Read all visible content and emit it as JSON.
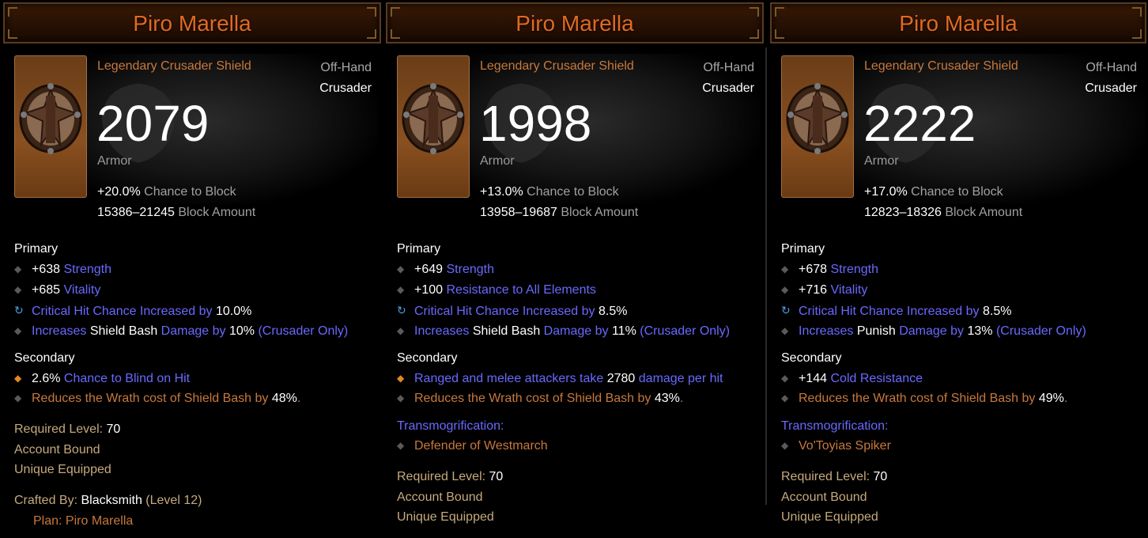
{
  "items": [
    {
      "name": "Piro Marella",
      "type_name": "Legendary Crusader Shield",
      "slot": "Off-Hand",
      "class_label": "Crusader",
      "armor": "2079",
      "armor_label": "Armor",
      "block_chance_value": "+20.0%",
      "block_chance_label": "Chance to Block",
      "block_amount_value": "15386–21245",
      "block_amount_label": "Block Amount",
      "primary_title": "Primary",
      "primary": [
        {
          "value": "+638",
          "label": "Strength"
        },
        {
          "value": "+685",
          "label": "Vitality"
        },
        {
          "label": "Critical Hit Chance Increased by",
          "value": "10.0%"
        },
        {
          "p1": "Increases",
          "skill": "Shield Bash",
          "p2": "Damage by",
          "value": "10%",
          "suffix": "(Crusader Only)"
        }
      ],
      "secondary_title": "Secondary",
      "secondary": [
        {
          "value": "2.6%",
          "label": "Chance to Blind on Hit"
        },
        {
          "label": "Reduces the Wrath cost of Shield Bash by",
          "value": "48%",
          "end": "."
        }
      ],
      "required_level_label": "Required Level:",
      "required_level_value": "70",
      "account_bound": "Account Bound",
      "unique_equipped": "Unique Equipped",
      "crafted_label": "Crafted By:",
      "crafted_by": "Blacksmith",
      "crafted_level": "(Level 12)",
      "plan": "Plan: Piro Marella"
    },
    {
      "name": "Piro Marella",
      "type_name": "Legendary Crusader Shield",
      "slot": "Off-Hand",
      "class_label": "Crusader",
      "armor": "1998",
      "armor_label": "Armor",
      "block_chance_value": "+13.0%",
      "block_chance_label": "Chance to Block",
      "block_amount_value": "13958–19687",
      "block_amount_label": "Block Amount",
      "primary_title": "Primary",
      "primary": [
        {
          "value": "+649",
          "label": "Strength"
        },
        {
          "value": "+100",
          "label": "Resistance to All Elements"
        },
        {
          "label": "Critical Hit Chance Increased by",
          "value": "8.5%"
        },
        {
          "p1": "Increases",
          "skill": "Shield Bash",
          "p2": "Damage by",
          "value": "11%",
          "suffix": "(Crusader Only)"
        }
      ],
      "secondary_title": "Secondary",
      "secondary": [
        {
          "p1": "Ranged and melee attackers take",
          "value": "2780",
          "p2": "damage per hit"
        },
        {
          "label": "Reduces the Wrath cost of Shield Bash by",
          "value": "43%",
          "end": "."
        }
      ],
      "transmog_title": "Transmogrification:",
      "transmog": "Defender of Westmarch",
      "required_level_label": "Required Level:",
      "required_level_value": "70",
      "account_bound": "Account Bound",
      "unique_equipped": "Unique Equipped"
    },
    {
      "name": "Piro Marella",
      "type_name": "Legendary Crusader Shield",
      "slot": "Off-Hand",
      "class_label": "Crusader",
      "armor": "2222",
      "armor_label": "Armor",
      "block_chance_value": "+17.0%",
      "block_chance_label": "Chance to Block",
      "block_amount_value": "12823–18326",
      "block_amount_label": "Block Amount",
      "primary_title": "Primary",
      "primary": [
        {
          "value": "+678",
          "label": "Strength"
        },
        {
          "value": "+716",
          "label": "Vitality"
        },
        {
          "label": "Critical Hit Chance Increased by",
          "value": "8.5%"
        },
        {
          "p1": "Increases",
          "skill": "Punish",
          "p2": "Damage by",
          "value": "13%",
          "suffix": "(Crusader Only)"
        }
      ],
      "secondary_title": "Secondary",
      "secondary": [
        {
          "value": "+144",
          "label": "Cold Resistance"
        },
        {
          "label": "Reduces the Wrath cost of Shield Bash by",
          "value": "49%",
          "end": "."
        }
      ],
      "transmog_title": "Transmogrification:",
      "transmog": "Vo'Toyias Spiker",
      "required_level_label": "Required Level:",
      "required_level_value": "70",
      "account_bound": "Account Bound",
      "unique_equipped": "Unique Equipped"
    }
  ],
  "icons": {
    "affix_bullet": "diamond-bullet-icon",
    "crit_bullet": "cycle-icon",
    "legendary_bullet": "orange-diamond-icon"
  },
  "colors": {
    "legendary_orange": "#c8783c",
    "title_orange": "#e06a22",
    "magic_blue": "#6969ff",
    "tan": "#c6a97c"
  }
}
